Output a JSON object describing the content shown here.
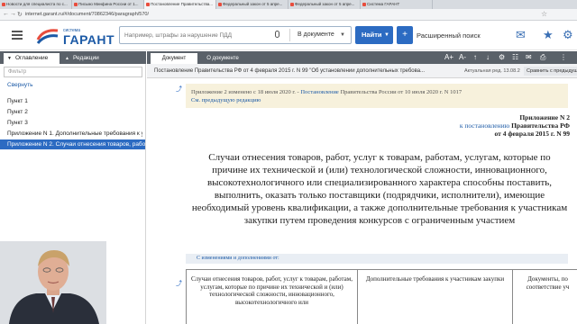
{
  "browser": {
    "tabs": [
      {
        "label": "Новости для специалиста по с..."
      },
      {
        "label": "Письмо Минфина России от 1..."
      },
      {
        "label": "Постановление Правительства..."
      },
      {
        "label": "Федеральный закон от 5 апре..."
      },
      {
        "label": "Федеральный закон от 5 апре..."
      },
      {
        "label": "Система ГАРАНТ"
      }
    ],
    "url": "internet.garant.ru/#/document/70862346/paragraph/570/"
  },
  "header": {
    "logo_small": "система",
    "logo_text": "ГАРАНТ",
    "search_placeholder": "Например, штрафы за нарушение ПДД",
    "search_scope": "В документе",
    "find_label": "Найти",
    "plus_label": "+",
    "advanced_search": "Расширенный поиск",
    "icons": [
      "mail-icon",
      "star-icon",
      "settings-icon"
    ]
  },
  "left_panel": {
    "tab_toc": "Оглавление",
    "tab_editions": "Редакции",
    "filter_placeholder": "Фильтр",
    "collapse": "Свернуть",
    "items": [
      {
        "label": "Пункт 1"
      },
      {
        "label": "Пункт 2"
      },
      {
        "label": "Пункт 3"
      },
      {
        "label": "Приложение N 1. Дополнительные требования к у..."
      },
      {
        "label": "Приложение N 2. Случаи отнесения товаров, работ"
      }
    ]
  },
  "document": {
    "tab_document": "Документ",
    "tab_about": "О документе",
    "tools": [
      "A+",
      "A-",
      "↑",
      "↓",
      "⚙",
      "☷",
      "✉",
      "⎙",
      "⋮"
    ],
    "title": "Постановление Правительства РФ от 4 февраля 2015 г. N 99 \"Об установлении дополнительных требова...",
    "version": "Актуальная ред. 13.08.2020 - ?",
    "compare": "Сравнить с предыдущей",
    "note_line1_prefix": "Приложение 2 изменено с 18 июля 2020 г. - ",
    "note_line1_link": "Постановление",
    "note_line1_suffix": " Правительства России от 10 июля 2020 г. N 1017",
    "note_line2": "См. предыдущую редакцию",
    "appendix_line1": "Приложение N 2",
    "appendix_line2_link": "к постановлению",
    "appendix_line2_rest": " Правительства РФ",
    "appendix_line3": "от 4 февраля 2015 г. N 99",
    "heading": "Случаи отнесения товаров, работ, услуг к товарам, работам, услугам, которые по причине их технической и (или) технологической сложности, инновационного, высокотехнологичного или специализированного характера способны поставить, выполнить, оказать только поставщики (подрядчики, исполнители), имеющие необходимый уровень квалификации, а также дополнительные требования к участникам закупки путем проведения конкурсов с ограниченным участием",
    "changes_link": "С изменениями и дополнениями от:",
    "table_headers": [
      "Случаи отнесения товаров, работ, услуг к товарам, работам, услугам, которые по причине их технической и (или) технологической сложности, инновационного, высокотехнологичного или",
      "Дополнительные требования к участникам закупки",
      "Документы, по соответствие уч"
    ]
  }
}
